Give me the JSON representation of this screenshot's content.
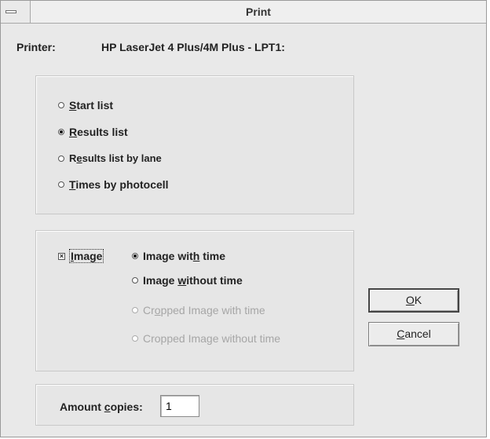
{
  "window": {
    "title": "Print"
  },
  "printer": {
    "label": "Printer:",
    "name": "HP LaserJet 4 Plus/4M Plus - LPT1:"
  },
  "list_options": [
    {
      "pre": "",
      "ul": "S",
      "post": "tart list",
      "checked": false
    },
    {
      "pre": "",
      "ul": "R",
      "post": "esults list",
      "checked": true
    },
    {
      "pre": "R",
      "ul": "e",
      "post": "sults list by lane",
      "checked": false
    },
    {
      "pre": "",
      "ul": "T",
      "post": "imes by photocell",
      "checked": false
    }
  ],
  "image_group": {
    "checkbox": {
      "ul": "I",
      "post": "mage",
      "checked": true
    },
    "options": [
      {
        "pre": "Image wit",
        "ul": "h",
        "post": " time",
        "checked": true,
        "disabled": false
      },
      {
        "pre": "Image ",
        "ul": "w",
        "post": "ithout time",
        "checked": false,
        "disabled": false
      },
      {
        "pre": "Cr",
        "ul": "o",
        "post": "pped Image with time",
        "checked": false,
        "disabled": true
      },
      {
        "pre": "Cropped Image without time",
        "ul": "",
        "post": "",
        "checked": false,
        "disabled": true
      }
    ]
  },
  "copies": {
    "pre": "Amount ",
    "ul": "c",
    "post": "opies:",
    "value": "1"
  },
  "buttons": {
    "ok": {
      "pre": "",
      "ul": "O",
      "post": "K"
    },
    "cancel": {
      "pre": "",
      "ul": "C",
      "post": "ancel"
    }
  }
}
